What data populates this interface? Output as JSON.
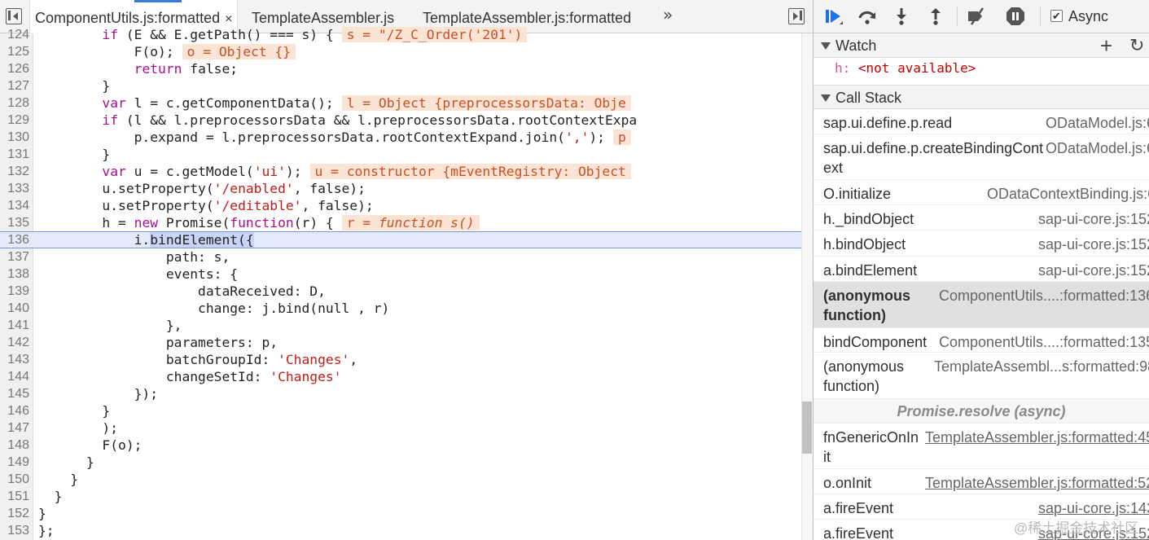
{
  "editor": {
    "tabs": [
      {
        "label": "ComponentUtils.js:formatted",
        "close": "×",
        "active": true
      },
      {
        "label": "TemplateAssembler.js",
        "active": false
      },
      {
        "label": "TemplateAssembler.js:formatted",
        "active": false
      }
    ],
    "more_tabs": "»",
    "highlighted_line": "136",
    "lines": [
      {
        "n": "124",
        "html": "        <span class='kw'>if</span> (E &amp;&amp; E.getPath() === s) {<span class='inline-val'>s = \"/Z_C_Order('201')</span>"
      },
      {
        "n": "125",
        "html": "            F(o);<span class='inline-val'>o = Object {}</span>"
      },
      {
        "n": "126",
        "html": "            <span class='kw'>return</span> false;"
      },
      {
        "n": "127",
        "html": "        }"
      },
      {
        "n": "128",
        "html": "        <span class='kw'>var</span> l = c.getComponentData();<span class='inline-val'>l = Object {preprocessorsData: Obje</span>"
      },
      {
        "n": "129",
        "html": "        <span class='kw'>if</span> (l &amp;&amp; l.preprocessorsData &amp;&amp; l.preprocessorsData.rootContextExpa"
      },
      {
        "n": "130",
        "html": "            p.expand = l.preprocessorsData.rootContextExpand.join(<span class='str'>','</span>);<span class='inline-val'>p</span>"
      },
      {
        "n": "131",
        "html": "        }"
      },
      {
        "n": "132",
        "html": "        <span class='kw'>var</span> u = c.getModel(<span class='str'>'ui'</span>);<span class='inline-val'>u = constructor {mEventRegistry: Object</span>"
      },
      {
        "n": "133",
        "html": "        u.setProperty(<span class='str'>'/enabled'</span>, false);"
      },
      {
        "n": "134",
        "html": "        u.setProperty(<span class='str'>'/editable'</span>, false);"
      },
      {
        "n": "135",
        "html": "        h = <span class='kw'>new</span> Promise(<span class='kw'>function</span>(r) {<span class='inline-val'>r = <i>function s()</i></span>"
      },
      {
        "n": "136",
        "html": "            i.<span class='sel'>bindElement({</span>"
      },
      {
        "n": "137",
        "html": "                path: s,"
      },
      {
        "n": "138",
        "html": "                events: {"
      },
      {
        "n": "139",
        "html": "                    dataReceived: D,"
      },
      {
        "n": "140",
        "html": "                    change: j.bind(null , r)"
      },
      {
        "n": "141",
        "html": "                },"
      },
      {
        "n": "142",
        "html": "                parameters: p,"
      },
      {
        "n": "143",
        "html": "                batchGroupId: <span class='str'>'Changes'</span>,"
      },
      {
        "n": "144",
        "html": "                changeSetId: <span class='str'>'Changes'</span>"
      },
      {
        "n": "145",
        "html": "            });"
      },
      {
        "n": "146",
        "html": "        }"
      },
      {
        "n": "147",
        "html": "        );"
      },
      {
        "n": "148",
        "html": "        F(o);"
      },
      {
        "n": "149",
        "html": "      }"
      },
      {
        "n": "150",
        "html": "    }"
      },
      {
        "n": "151",
        "html": "  }"
      },
      {
        "n": "152",
        "html": "}"
      },
      {
        "n": "153",
        "html": "};"
      }
    ]
  },
  "debugger": {
    "toolbar": {
      "resume_icon": "resume-icon",
      "step_over_icon": "step-over-icon",
      "step_into_icon": "step-into-icon",
      "step_out_icon": "step-out-icon",
      "deactivate_breakpoints_icon": "deactivate-breakpoints-icon",
      "pause_on_exceptions_icon": "pause-on-exceptions-icon",
      "async_checked": "✔",
      "async_label": "Async"
    },
    "watch": {
      "title": "Watch",
      "add": "+",
      "refresh": "↻",
      "item_name": "h:",
      "item_value": "<not available>"
    },
    "call_stack": {
      "title": "Call Stack",
      "frames": [
        {
          "fn": "sap.ui.define.p.read",
          "loc": "ODataModel.js:6"
        },
        {
          "fn": "sap.ui.define.p.createBindingCont ext",
          "loc": "ODataModel.js:6"
        },
        {
          "fn": "O.initialize",
          "loc": "ODataContextBinding.js:6"
        },
        {
          "fn": "h._bindObject",
          "loc": "sap-ui-core.js:152"
        },
        {
          "fn": "h.bindObject",
          "loc": "sap-ui-core.js:152"
        },
        {
          "fn": "a.bindElement",
          "loc": "sap-ui-core.js:152"
        },
        {
          "fn": "(anonymous function)",
          "loc": "ComponentUtils....:formatted:136"
        },
        {
          "fn": "bindComponent",
          "loc": "ComponentUtils....:formatted:135"
        },
        {
          "fn": "(anonymous function)",
          "loc": "TemplateAssembl...s:formatted:98"
        },
        {
          "fn": "fnGenericOnIn it",
          "loc": "TemplateAssembler.js:formatted:45"
        },
        {
          "fn": "o.onInit",
          "loc": "TemplateAssembler.js:formatted:52"
        },
        {
          "fn": "a.fireEvent",
          "loc": "sap-ui-core.js:143"
        },
        {
          "fn": "a.fireEvent",
          "loc": "sap-ui-core.js:152"
        }
      ],
      "async_separator": "Promise.resolve (async)"
    },
    "watermark": "@稀土掘金技术社区"
  },
  "colors": {
    "accent": "#1a73e8",
    "keyword": "#aa0d91",
    "string": "#c41a16",
    "inline_value_bg": "#fbe4d4",
    "inline_value_text": "#c8512a",
    "highlight_line": "#e3ebfc"
  }
}
